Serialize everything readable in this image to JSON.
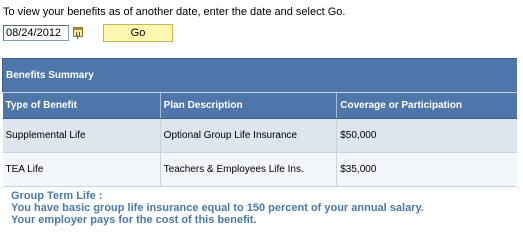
{
  "instruction": "To view your benefits as of another date, enter the date and select Go.",
  "date_field": {
    "value": "08/24/2012"
  },
  "go_button": {
    "label": "Go"
  },
  "icons": {
    "calendar": "calendar-icon"
  },
  "colors": {
    "header_bg": "#4f76a8",
    "header_text": "#ffffff",
    "go_button_bg": "#fdf7b0",
    "row_odd_bg": "#dde5ef",
    "row_even_bg": "#f3f6fa",
    "footnote_text": "#4c7aa8"
  },
  "benefits_summary": {
    "title": "Benefits Summary",
    "columns": [
      "Type of Benefit",
      "Plan Description",
      "Coverage or Participation"
    ],
    "rows": [
      [
        "Supplemental Life",
        "Optional Group Life Insurance",
        "$50,000"
      ],
      [
        "TEA Life",
        "Teachers & Employees Life Ins.",
        "$35,000"
      ]
    ]
  },
  "group_term_life": {
    "heading": "Group Term Life :",
    "line1": "You have basic group life insurance equal to 150 percent of your annual salary.",
    "line2": "Your employer pays for the cost of this benefit."
  }
}
